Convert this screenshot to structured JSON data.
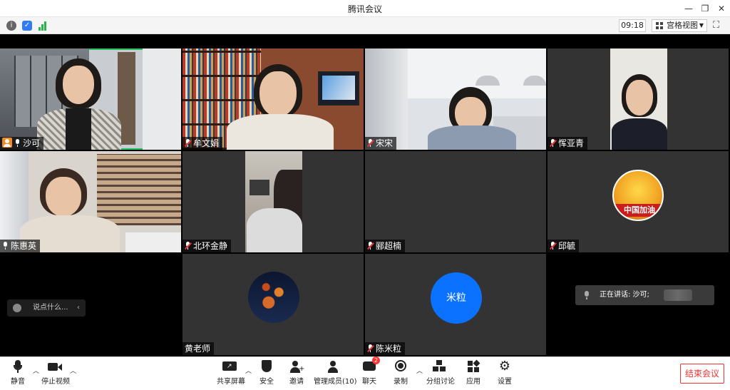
{
  "window": {
    "title": "腾讯会议"
  },
  "status": {
    "time": "09:18",
    "view_mode": "宫格视图"
  },
  "participants": [
    {
      "name": "沙可",
      "host": true
    },
    {
      "name": "牟文娟"
    },
    {
      "name": "宋宋"
    },
    {
      "name": "恽亚青"
    },
    {
      "name": "陈惠英"
    },
    {
      "name": "北环金静"
    },
    {
      "name": "郦超楠"
    },
    {
      "name": "邱毓"
    },
    {
      "name": "黄老师"
    },
    {
      "name": "陈米粒",
      "avatar_text": "米粒"
    }
  ],
  "avatar_text_xiu": "中国加油",
  "chat": {
    "placeholder": "说点什么..."
  },
  "speaking": {
    "text": "正在讲话: 沙可;"
  },
  "toolbar": {
    "mute": "静音",
    "stop_video": "停止视频",
    "share": "共享屏幕",
    "security": "安全",
    "invite": "邀请",
    "members": "管理成员(10)",
    "chat": "聊天",
    "chat_badge": "2",
    "record": "录制",
    "breakout": "分组讨论",
    "apps": "应用",
    "settings": "设置",
    "end": "结束会议"
  },
  "colors": {
    "active_speaker": "#21c35a",
    "end": "#e33333",
    "avatar_blue": "#0a72ff"
  }
}
